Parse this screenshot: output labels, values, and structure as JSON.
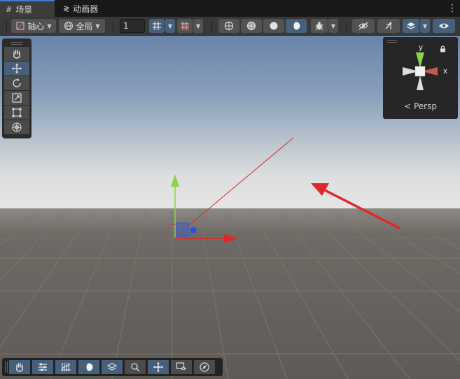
{
  "tabs": [
    {
      "icon": "grid-icon",
      "label": "场景",
      "active": true
    },
    {
      "icon": "animator-icon",
      "label": "动画器",
      "active": false
    }
  ],
  "toolbar": {
    "pivot_label": "轴心",
    "global_label": "全局",
    "grid_snap_value": "1",
    "buttons": [
      "draw-mode",
      "shading-2d",
      "lighting",
      "audio",
      "effects",
      "gizmos",
      "hidden-objects",
      "layers",
      "visibility"
    ]
  },
  "tools": [
    "hand",
    "move",
    "rotate",
    "scale",
    "rect",
    "transform"
  ],
  "active_tool": "move",
  "gizmo": {
    "y_label": "y",
    "x_label": "x",
    "projection_label": "Persp",
    "colors": {
      "x": "#c8574e",
      "y": "#8bd34a",
      "z": "#4a7fd6"
    }
  },
  "overlay_tools": [
    "hand",
    "inspector",
    "grid",
    "shading",
    "layers",
    "search",
    "move-scene",
    "camera-preview",
    "navigate"
  ],
  "colors": {
    "accent": "#3a7fd6",
    "selected_button": "#46607c",
    "ground": "#645f5b",
    "sky_top": "#6a85ab",
    "annotation_arrow": "#e0262a"
  }
}
